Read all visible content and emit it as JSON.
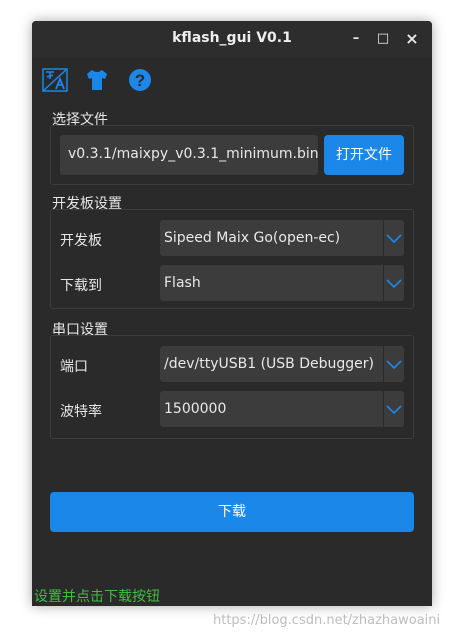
{
  "window": {
    "title": "kflash_gui V0.1",
    "controls": {
      "minimize": "–",
      "maximize": "□",
      "close": "×"
    }
  },
  "toolbar": {
    "icons": [
      "translate-icon",
      "tshirt-icon",
      "help-icon"
    ],
    "help_glyph": "?"
  },
  "file_group": {
    "label": "选择文件",
    "path_value": "v0.3.1/maixpy_v0.3.1_minimum.bin",
    "open_button": "打开文件"
  },
  "board_group": {
    "label": "开发板设置",
    "board_label": "开发板",
    "board_value": "Sipeed Maix Go(open-ec)",
    "target_label": "下载到",
    "target_value": "Flash"
  },
  "serial_group": {
    "label": "串口设置",
    "port_label": "端口",
    "port_value": "/dev/ttyUSB1 (USB Debugger)",
    "baud_label": "波特率",
    "baud_value": "1500000"
  },
  "download_button": "下载",
  "status_text": "设置并点击下载按钮",
  "watermark": "https://blog.csdn.net/zhazhawoaini",
  "colors": {
    "accent": "#1b87e8",
    "status": "#3fbf3f",
    "background": "#2a2a2a"
  }
}
